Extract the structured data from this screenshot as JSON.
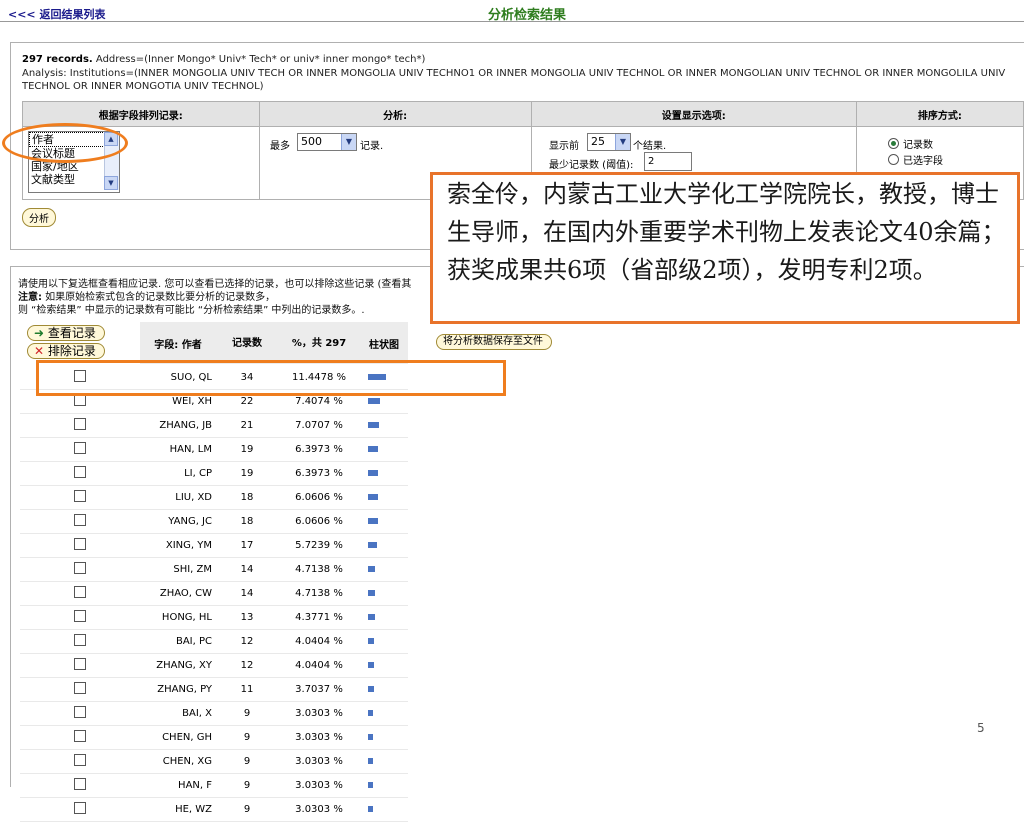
{
  "header": {
    "back_link": "<<< 返回结果列表",
    "title": "分析检索结果"
  },
  "summary": {
    "records": "297 records.",
    "address": " Address=(Inner Mongo* Univ* Tech* or univ* inner mongo* tech*)",
    "analysis": "Analysis:  Institutions=(INNER MONGOLIA UNIV TECH OR INNER MONGOLIA UNIV TECHNO1 OR INNER MONGOLIA UNIV TECHNOL OR INNER MONGOLIAN UNIV TECHNOL OR INNER MONGOLILA UNIV TECHNOL OR INNER MONGOTIA UNIV TECHNOL)"
  },
  "options": {
    "headers": [
      "根据字段排列记录:",
      "分析:",
      "设置显示选项:",
      "排序方式:"
    ],
    "field_list": [
      "作者",
      "会议标题",
      "国家/地区",
      "文献类型"
    ],
    "max_label": "最多",
    "max_value": "500",
    "max_unit": "记录.",
    "show_first_label": "显示前",
    "show_first_value": "25",
    "show_first_unit": "个结果.",
    "min_count_label": "最少记录数 (阈值):",
    "min_count_value": "2",
    "sort_by_count": "记录数",
    "sort_by_field": "已选字段",
    "analyze_button": "分析"
  },
  "notes": {
    "line1": "请使用以下复选框查看相应记录. 您可以查看已选择的记录，也可以排除这些记录 (查看其",
    "line2_bold": "注意:",
    "line2": " 如果原始检索式包含的记录数比要分析的记录数多，",
    "line3": "则 “检索结果” 中显示的记录数有可能比 “分析检索结果” 中列出的记录数多。."
  },
  "actions": {
    "view_records": "查看记录",
    "exclude_records": "排除记录",
    "save_to_file": "将分析数据保存至文件"
  },
  "results": {
    "col_field": "字段: 作者",
    "col_count": "记录数",
    "col_pct": "%，共 297",
    "col_bar": "柱状图",
    "rows": [
      {
        "name": "SUO, QL",
        "count": "34",
        "pct": "11.4478 %",
        "frac": 0.114478
      },
      {
        "name": "WEI, XH",
        "count": "22",
        "pct": "7.4074 %",
        "frac": 0.074074
      },
      {
        "name": "ZHANG, JB",
        "count": "21",
        "pct": "7.0707 %",
        "frac": 0.070707
      },
      {
        "name": "HAN, LM",
        "count": "19",
        "pct": "6.3973 %",
        "frac": 0.063973
      },
      {
        "name": "LI, CP",
        "count": "19",
        "pct": "6.3973 %",
        "frac": 0.063973
      },
      {
        "name": "LIU, XD",
        "count": "18",
        "pct": "6.0606 %",
        "frac": 0.060606
      },
      {
        "name": "YANG, JC",
        "count": "18",
        "pct": "6.0606 %",
        "frac": 0.060606
      },
      {
        "name": "XING, YM",
        "count": "17",
        "pct": "5.7239 %",
        "frac": 0.057239
      },
      {
        "name": "SHI, ZM",
        "count": "14",
        "pct": "4.7138 %",
        "frac": 0.047138
      },
      {
        "name": "ZHAO, CW",
        "count": "14",
        "pct": "4.7138 %",
        "frac": 0.047138
      },
      {
        "name": "HONG, HL",
        "count": "13",
        "pct": "4.3771 %",
        "frac": 0.043771
      },
      {
        "name": "BAI, PC",
        "count": "12",
        "pct": "4.0404 %",
        "frac": 0.040404
      },
      {
        "name": "ZHANG, XY",
        "count": "12",
        "pct": "4.0404 %",
        "frac": 0.040404
      },
      {
        "name": "ZHANG, PY",
        "count": "11",
        "pct": "3.7037 %",
        "frac": 0.037037
      },
      {
        "name": "BAI, X",
        "count": "9",
        "pct": "3.0303 %",
        "frac": 0.030303
      },
      {
        "name": "CHEN, GH",
        "count": "9",
        "pct": "3.0303 %",
        "frac": 0.030303
      },
      {
        "name": "CHEN, XG",
        "count": "9",
        "pct": "3.0303 %",
        "frac": 0.030303
      },
      {
        "name": "HAN, F",
        "count": "9",
        "pct": "3.0303 %",
        "frac": 0.030303
      },
      {
        "name": "HE, WZ",
        "count": "9",
        "pct": "3.0303 %",
        "frac": 0.030303
      }
    ]
  },
  "callout": {
    "text": "索全伶，内蒙古工业大学化工学院院长，教授，博士生导师，在国内外重要学术刊物上发表论文40余篇；获奖成果共6项（省部级2项），发明专利2项。"
  },
  "slide": {
    "page_number": "5"
  },
  "colors": {
    "accent": "#ef7d1e",
    "bar": "#4a74c2",
    "title_green": "#2e7d1e"
  }
}
